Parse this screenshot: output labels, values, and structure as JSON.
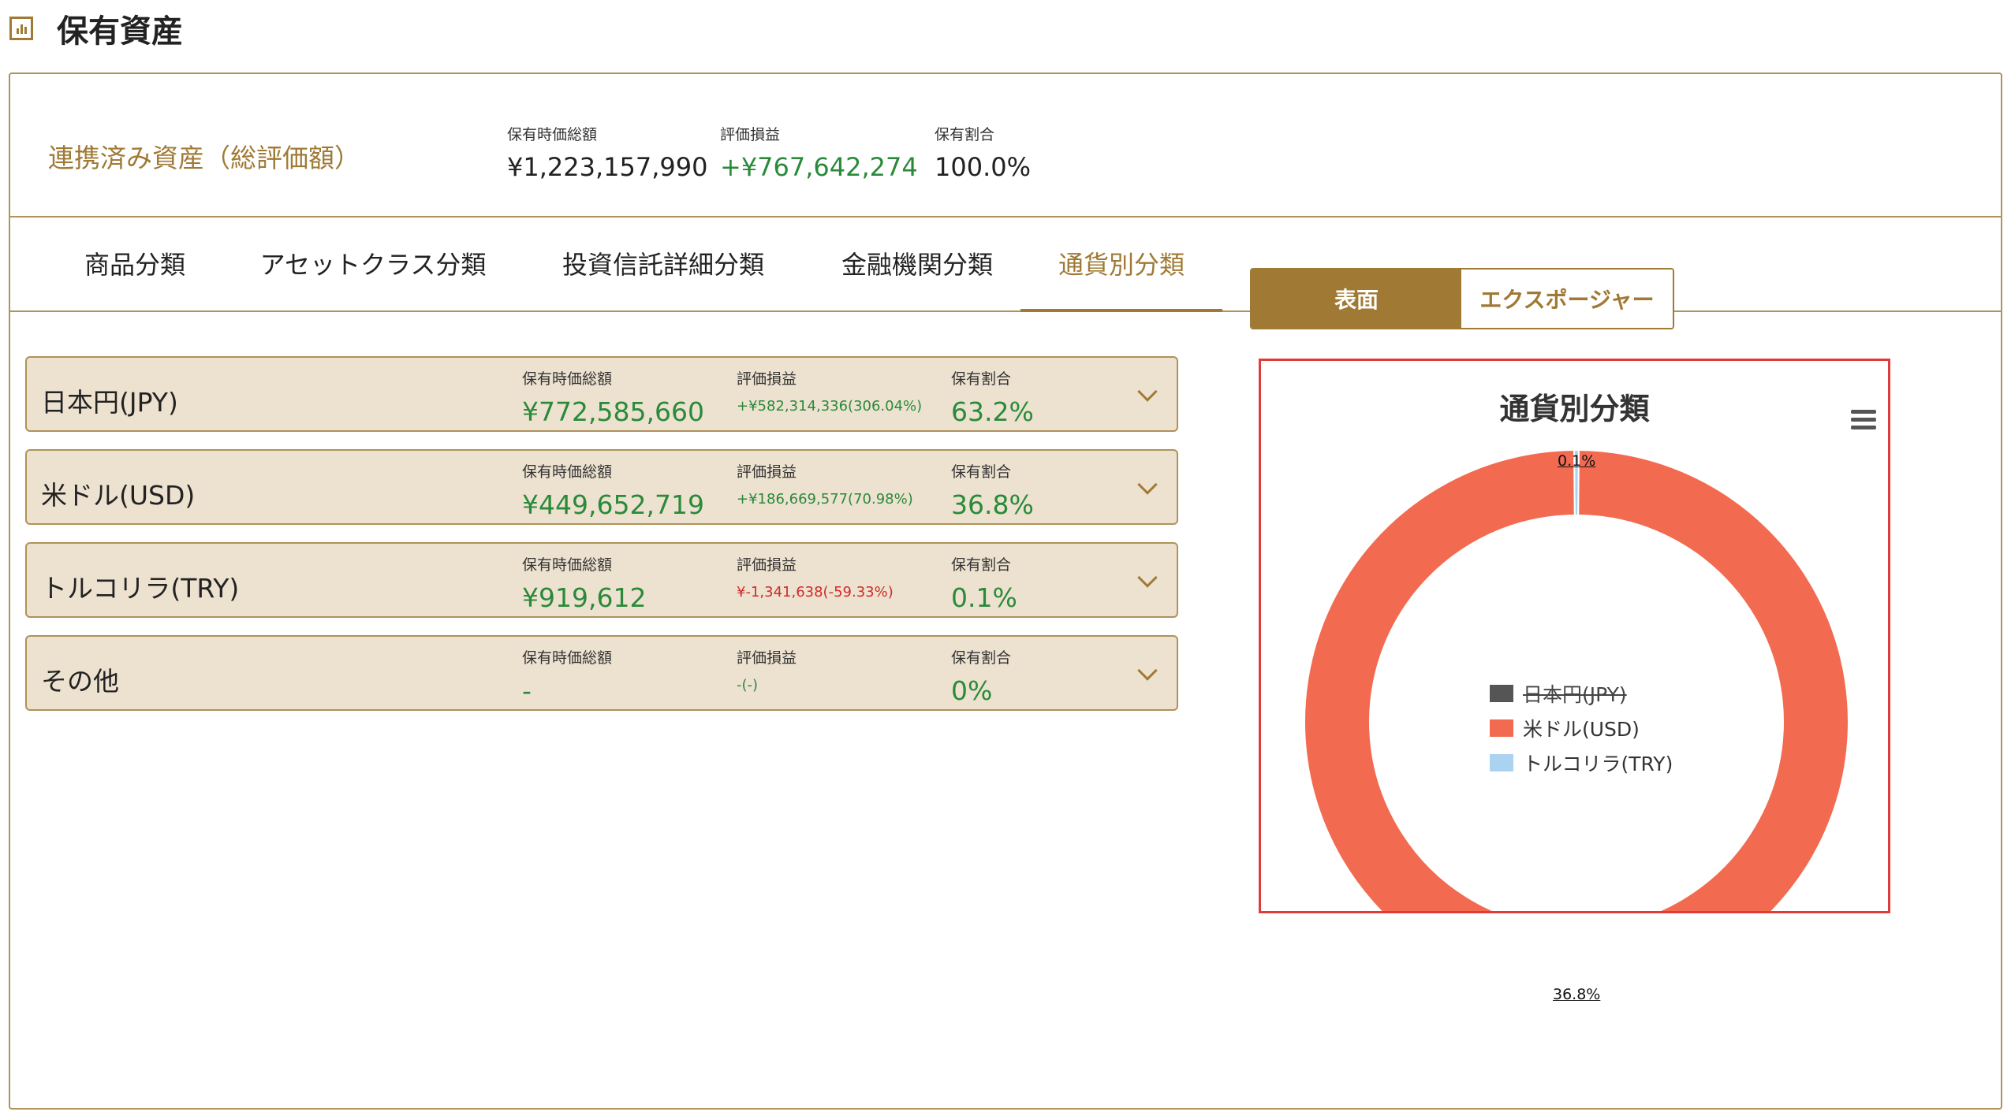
{
  "page": {
    "title": "保有資産",
    "icon": "bar-chart-icon"
  },
  "summary": {
    "label": "連携済み資産（総評価額）",
    "market_value_label": "保有時価総額",
    "market_value": "¥1,223,157,990",
    "gain_label": "評価損益",
    "gain": "+¥767,642,274",
    "ratio_label": "保有割合",
    "ratio": "100.0%"
  },
  "tabs": [
    {
      "label": "商品分類"
    },
    {
      "label": "アセットクラス分類"
    },
    {
      "label": "投資信託詳細分類"
    },
    {
      "label": "金融機関分類"
    },
    {
      "label": "通貨別分類",
      "active": true
    }
  ],
  "rows": [
    {
      "name": "日本円(JPY)",
      "market_value_label": "保有時価総額",
      "market_value": "¥772,585,660",
      "gain_label": "評価損益",
      "gain": "+¥582,314,336(306.04%)",
      "ratio_label": "保有割合",
      "ratio": "63.2%"
    },
    {
      "name": "米ドル(USD)",
      "market_value_label": "保有時価総額",
      "market_value": "¥449,652,719",
      "gain_label": "評価損益",
      "gain": "+¥186,669,577(70.98%)",
      "ratio_label": "保有割合",
      "ratio": "36.8%"
    },
    {
      "name": "トルコリラ(TRY)",
      "market_value_label": "保有時価総額",
      "market_value": "¥919,612",
      "gain_label": "評価損益",
      "gain": "¥-1,341,638(-59.33%)",
      "ratio_label": "保有割合",
      "ratio": "0.1%"
    },
    {
      "name": "その他",
      "market_value_label": "保有時価総額",
      "market_value": "-",
      "gain_label": "評価損益",
      "gain": "-(-)",
      "ratio_label": "保有割合",
      "ratio": "0%"
    }
  ],
  "toggle": {
    "active_label": "表面",
    "inactive_label": "エクスポージャー"
  },
  "colors": {
    "accent": "#a07a35",
    "positive": "#2a8a3a",
    "negative": "#d02a2a",
    "usd": "#f26b50",
    "try": "#a9d3f0",
    "jpy": "#555555"
  },
  "chart_data": {
    "type": "pie",
    "title": "通貨別分類",
    "donut": true,
    "series": [
      {
        "name": "日本円(JPY)",
        "value": 63.2,
        "visible": false,
        "color": "#555555"
      },
      {
        "name": "米ドル(USD)",
        "value": 36.8,
        "visible": true,
        "color": "#f26b50",
        "data_label": "36.8%"
      },
      {
        "name": "トルコリラ(TRY)",
        "value": 0.1,
        "visible": true,
        "color": "#a9d3f0",
        "data_label": "0.1%"
      }
    ],
    "legend_position": "center"
  }
}
